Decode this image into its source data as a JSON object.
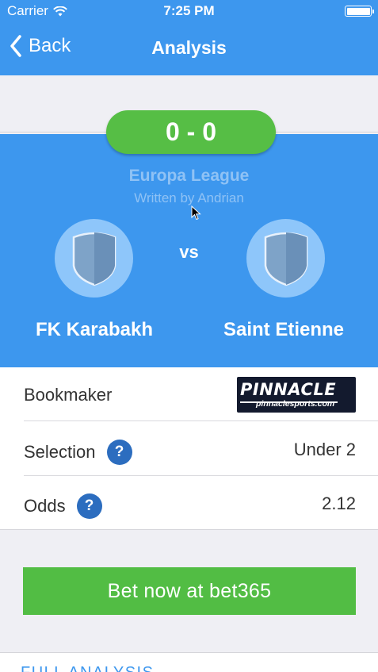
{
  "status": {
    "carrier": "Carrier",
    "time": "7:25 PM"
  },
  "nav": {
    "back_label": "Back",
    "title": "Analysis"
  },
  "match": {
    "score": "0 - 0",
    "competition": "Europa League",
    "author": "Written by Andrian",
    "vs": "vs",
    "home_team": "FK Karabakh",
    "away_team": "Saint Etienne"
  },
  "details": {
    "bookmaker_label": "Bookmaker",
    "bookmaker_logo_text": "PINNACLE",
    "bookmaker_logo_sub": "pinnaclesports.com",
    "selection_label": "Selection",
    "selection_value": "Under 2",
    "odds_label": "Odds",
    "odds_value": "2.12",
    "help_glyph": "?"
  },
  "cta_label": "Bet now at bet365",
  "footer_link": "FULL ANALYSIS",
  "colors": {
    "header": "#3d97ee",
    "score": "#56be45",
    "cta": "#52bd44",
    "help": "#2c6dbf"
  },
  "icons": [
    "wifi-icon",
    "battery-icon",
    "back-chevron-icon",
    "shield-icon",
    "help-icon",
    "cursor-icon"
  ]
}
